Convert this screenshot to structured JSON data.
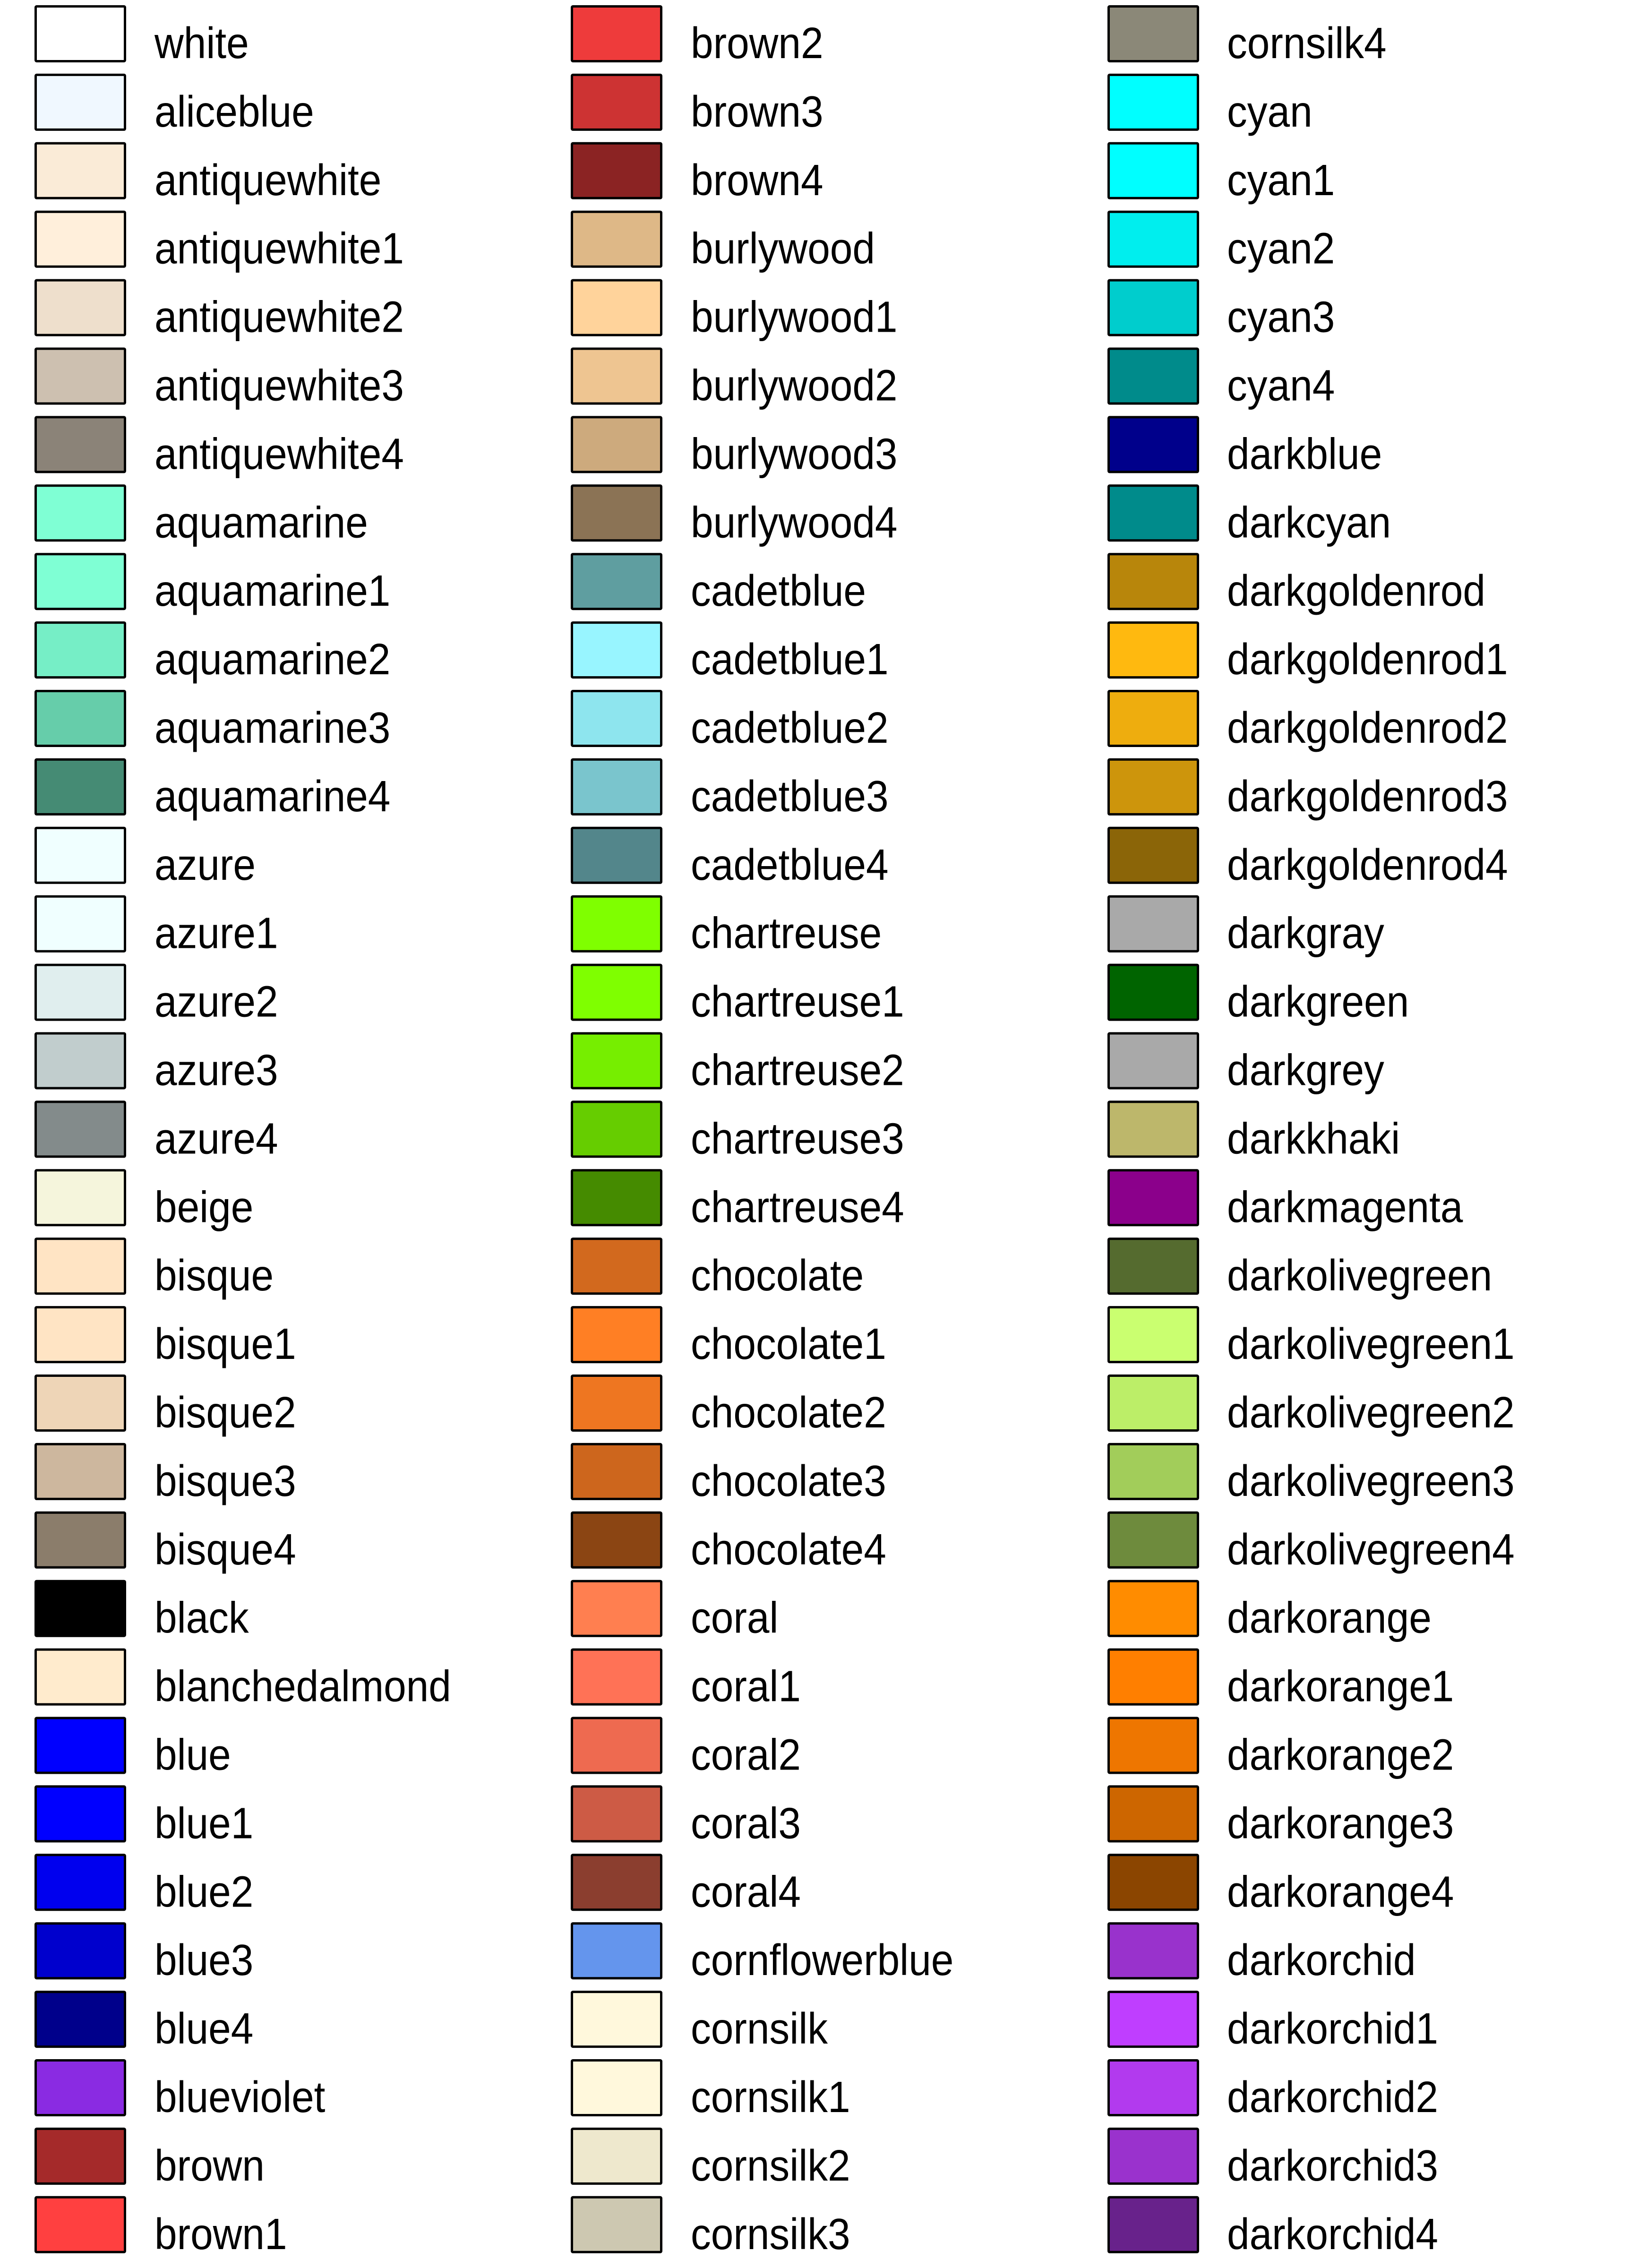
{
  "chart_data": {
    "type": "table",
    "title": "",
    "description": "R named color swatch chart (colors() order), three columns",
    "columns": 3,
    "rows_per_column": 33,
    "border_color": "#000000",
    "entries": [
      {
        "name": "white",
        "hex": "#FFFFFF"
      },
      {
        "name": "aliceblue",
        "hex": "#F0F8FF"
      },
      {
        "name": "antiquewhite",
        "hex": "#FAEBD7"
      },
      {
        "name": "antiquewhite1",
        "hex": "#FFEFDB"
      },
      {
        "name": "antiquewhite2",
        "hex": "#EEDFCC"
      },
      {
        "name": "antiquewhite3",
        "hex": "#CDC0B0"
      },
      {
        "name": "antiquewhite4",
        "hex": "#8B8378"
      },
      {
        "name": "aquamarine",
        "hex": "#7FFFD4"
      },
      {
        "name": "aquamarine1",
        "hex": "#7FFFD4"
      },
      {
        "name": "aquamarine2",
        "hex": "#76EEC6"
      },
      {
        "name": "aquamarine3",
        "hex": "#66CDAA"
      },
      {
        "name": "aquamarine4",
        "hex": "#458B74"
      },
      {
        "name": "azure",
        "hex": "#F0FFFF"
      },
      {
        "name": "azure1",
        "hex": "#F0FFFF"
      },
      {
        "name": "azure2",
        "hex": "#E0EEEE"
      },
      {
        "name": "azure3",
        "hex": "#C1CDCD"
      },
      {
        "name": "azure4",
        "hex": "#838B8B"
      },
      {
        "name": "beige",
        "hex": "#F5F5DC"
      },
      {
        "name": "bisque",
        "hex": "#FFE4C4"
      },
      {
        "name": "bisque1",
        "hex": "#FFE4C4"
      },
      {
        "name": "bisque2",
        "hex": "#EED5B7"
      },
      {
        "name": "bisque3",
        "hex": "#CDB79E"
      },
      {
        "name": "bisque4",
        "hex": "#8B7D6B"
      },
      {
        "name": "black",
        "hex": "#000000"
      },
      {
        "name": "blanchedalmond",
        "hex": "#FFEBCD"
      },
      {
        "name": "blue",
        "hex": "#0000FF"
      },
      {
        "name": "blue1",
        "hex": "#0000FF"
      },
      {
        "name": "blue2",
        "hex": "#0000EE"
      },
      {
        "name": "blue3",
        "hex": "#0000CD"
      },
      {
        "name": "blue4",
        "hex": "#00008B"
      },
      {
        "name": "blueviolet",
        "hex": "#8A2BE2"
      },
      {
        "name": "brown",
        "hex": "#A52A2A"
      },
      {
        "name": "brown1",
        "hex": "#FF4040"
      },
      {
        "name": "brown2",
        "hex": "#EE3B3B"
      },
      {
        "name": "brown3",
        "hex": "#CD3333"
      },
      {
        "name": "brown4",
        "hex": "#8B2323"
      },
      {
        "name": "burlywood",
        "hex": "#DEB887"
      },
      {
        "name": "burlywood1",
        "hex": "#FFD39B"
      },
      {
        "name": "burlywood2",
        "hex": "#EEC591"
      },
      {
        "name": "burlywood3",
        "hex": "#CDAA7D"
      },
      {
        "name": "burlywood4",
        "hex": "#8B7355"
      },
      {
        "name": "cadetblue",
        "hex": "#5F9EA0"
      },
      {
        "name": "cadetblue1",
        "hex": "#98F5FF"
      },
      {
        "name": "cadetblue2",
        "hex": "#8EE5EE"
      },
      {
        "name": "cadetblue3",
        "hex": "#7AC5CD"
      },
      {
        "name": "cadetblue4",
        "hex": "#53868B"
      },
      {
        "name": "chartreuse",
        "hex": "#7FFF00"
      },
      {
        "name": "chartreuse1",
        "hex": "#7FFF00"
      },
      {
        "name": "chartreuse2",
        "hex": "#76EE00"
      },
      {
        "name": "chartreuse3",
        "hex": "#66CD00"
      },
      {
        "name": "chartreuse4",
        "hex": "#458B00"
      },
      {
        "name": "chocolate",
        "hex": "#D2691E"
      },
      {
        "name": "chocolate1",
        "hex": "#FF7F24"
      },
      {
        "name": "chocolate2",
        "hex": "#EE7621"
      },
      {
        "name": "chocolate3",
        "hex": "#CD661D"
      },
      {
        "name": "chocolate4",
        "hex": "#8B4513"
      },
      {
        "name": "coral",
        "hex": "#FF7F50"
      },
      {
        "name": "coral1",
        "hex": "#FF7256"
      },
      {
        "name": "coral2",
        "hex": "#EE6A50"
      },
      {
        "name": "coral3",
        "hex": "#CD5B45"
      },
      {
        "name": "coral4",
        "hex": "#8B3E2F"
      },
      {
        "name": "cornflowerblue",
        "hex": "#6495ED"
      },
      {
        "name": "cornsilk",
        "hex": "#FFF8DC"
      },
      {
        "name": "cornsilk1",
        "hex": "#FFF8DC"
      },
      {
        "name": "cornsilk2",
        "hex": "#EEE8CD"
      },
      {
        "name": "cornsilk3",
        "hex": "#CDC8B1"
      },
      {
        "name": "cornsilk4",
        "hex": "#8B8878"
      },
      {
        "name": "cyan",
        "hex": "#00FFFF"
      },
      {
        "name": "cyan1",
        "hex": "#00FFFF"
      },
      {
        "name": "cyan2",
        "hex": "#00EEEE"
      },
      {
        "name": "cyan3",
        "hex": "#00CDCD"
      },
      {
        "name": "cyan4",
        "hex": "#008B8B"
      },
      {
        "name": "darkblue",
        "hex": "#00008B"
      },
      {
        "name": "darkcyan",
        "hex": "#008B8B"
      },
      {
        "name": "darkgoldenrod",
        "hex": "#B8860B"
      },
      {
        "name": "darkgoldenrod1",
        "hex": "#FFB90F"
      },
      {
        "name": "darkgoldenrod2",
        "hex": "#EEAD0E"
      },
      {
        "name": "darkgoldenrod3",
        "hex": "#CD950C"
      },
      {
        "name": "darkgoldenrod4",
        "hex": "#8B6508"
      },
      {
        "name": "darkgray",
        "hex": "#A9A9A9"
      },
      {
        "name": "darkgreen",
        "hex": "#006400"
      },
      {
        "name": "darkgrey",
        "hex": "#A9A9A9"
      },
      {
        "name": "darkkhaki",
        "hex": "#BDB76B"
      },
      {
        "name": "darkmagenta",
        "hex": "#8B008B"
      },
      {
        "name": "darkolivegreen",
        "hex": "#556B2F"
      },
      {
        "name": "darkolivegreen1",
        "hex": "#CAFF70"
      },
      {
        "name": "darkolivegreen2",
        "hex": "#BCEE68"
      },
      {
        "name": "darkolivegreen3",
        "hex": "#A2CD5A"
      },
      {
        "name": "darkolivegreen4",
        "hex": "#6E8B3D"
      },
      {
        "name": "darkorange",
        "hex": "#FF8C00"
      },
      {
        "name": "darkorange1",
        "hex": "#FF7F00"
      },
      {
        "name": "darkorange2",
        "hex": "#EE7600"
      },
      {
        "name": "darkorange3",
        "hex": "#CD6600"
      },
      {
        "name": "darkorange4",
        "hex": "#8B4500"
      },
      {
        "name": "darkorchid",
        "hex": "#9932CC"
      },
      {
        "name": "darkorchid1",
        "hex": "#BF3EFF"
      },
      {
        "name": "darkorchid2",
        "hex": "#B23AEE"
      },
      {
        "name": "darkorchid3",
        "hex": "#9A32CD"
      },
      {
        "name": "darkorchid4",
        "hex": "#68228B"
      }
    ]
  }
}
